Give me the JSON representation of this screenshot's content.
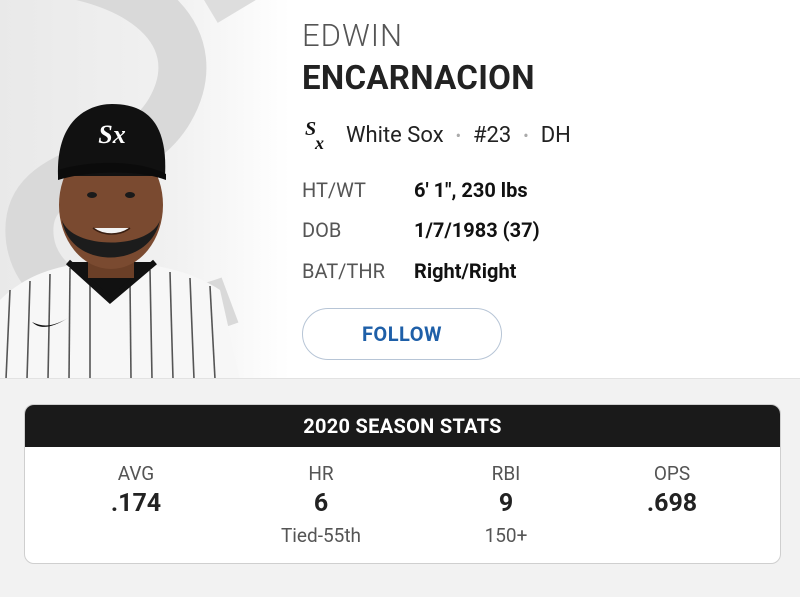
{
  "player": {
    "first_name": "EDWIN",
    "last_name": "ENCARNACION",
    "team": "White Sox",
    "number": "#23",
    "position": "DH"
  },
  "bio": [
    {
      "label": "HT/WT",
      "value": "6' 1\", 230 lbs"
    },
    {
      "label": "DOB",
      "value": "1/7/1983 (37)"
    },
    {
      "label": "BAT/THR",
      "value": "Right/Right"
    }
  ],
  "follow": {
    "label": "FOLLOW"
  },
  "stats": {
    "title": "2020 SEASON STATS",
    "items": [
      {
        "label": "AVG",
        "value": ".174",
        "rank": ""
      },
      {
        "label": "HR",
        "value": "6",
        "rank": "Tied-55th"
      },
      {
        "label": "RBI",
        "value": "9",
        "rank": "150+"
      },
      {
        "label": "OPS",
        "value": ".698",
        "rank": ""
      }
    ]
  },
  "colors": {
    "accent": "#1e5fa8",
    "header_bg": "#1a1a1a"
  },
  "icons": {
    "team_logo": "white-sox-logo-icon"
  }
}
